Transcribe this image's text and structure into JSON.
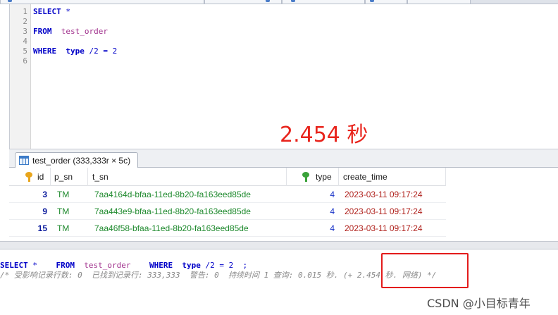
{
  "editor": {
    "line_numbers": [
      "1",
      "2",
      "3",
      "4",
      "5",
      "6"
    ],
    "line1": {
      "kw": "SELECT",
      "rest": " *"
    },
    "line3": {
      "kw": "FROM",
      "table": "test_order"
    },
    "line5": {
      "kw": "WHERE",
      "col": "type",
      "op": "/2 = 2"
    }
  },
  "timing_overlay": "2.454 秒",
  "result_tab": {
    "label": "test_order (333,333r × 5c)"
  },
  "grid": {
    "columns": [
      {
        "name": "id",
        "key_icon": "primary-key-icon"
      },
      {
        "name": "p_sn"
      },
      {
        "name": "t_sn"
      },
      {
        "name": "type",
        "key_icon": "index-key-icon"
      },
      {
        "name": "create_time"
      }
    ],
    "rows": [
      {
        "id": "3",
        "p_sn": "TM",
        "t_sn": "7aa4164d-bfaa-11ed-8b20-fa163eed85de",
        "type": "4",
        "create_time": "2023-03-11 09:17:24"
      },
      {
        "id": "9",
        "p_sn": "TM",
        "t_sn": "7aa443e9-bfaa-11ed-8b20-fa163eed85de",
        "type": "4",
        "create_time": "2023-03-11 09:17:24"
      },
      {
        "id": "15",
        "p_sn": "TM",
        "t_sn": "7aa46f58-bfaa-11ed-8b20-fa163eed85de",
        "type": "4",
        "create_time": "2023-03-11 09:17:24"
      }
    ]
  },
  "messages": {
    "sql": {
      "select": "SELECT",
      "star": " *",
      "from": "FROM",
      "table": "test_order",
      "where": "WHERE",
      "col": "type",
      "op": "/2 = 2",
      "semi": ";"
    },
    "result_comment": "/* 受影响记录行数: 0  已找到记录行: 333,333  警告: 0  持续时间 1 查询: 0.015 秒. (+ 2.454 秒. 网络) */"
  },
  "watermark": "CSDN @小目标青年",
  "colors": {
    "highlight_box": "#e31b1b",
    "timing_text": "#e8231b"
  }
}
